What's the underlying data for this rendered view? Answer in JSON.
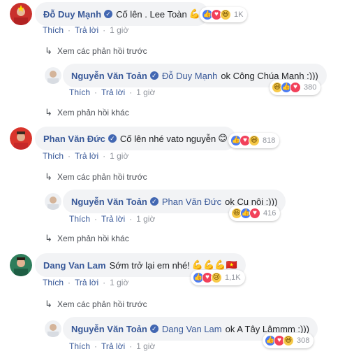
{
  "threads": [
    {
      "comment": {
        "author": "Đỗ Duy Mạnh",
        "text": "Cố lên . Lee Toàn",
        "emoji": "💪",
        "reaction_count": "1K",
        "reactions": [
          "like",
          "love",
          "haha"
        ]
      },
      "actions": {
        "like": "Thích",
        "reply": "Trả lời",
        "time": "1 giờ"
      },
      "more": "Xem các phản hồi trước",
      "reply": {
        "author": "Nguyễn Văn Toản",
        "tag": "Đỗ Duy Mạnh",
        "text": "ok Công Chúa Mạnh :)))",
        "reaction_count": "380",
        "reactions": [
          "haha",
          "like",
          "love"
        ]
      },
      "reply_actions": {
        "like": "Thích",
        "reply": "Trả lời",
        "time": "1 giờ"
      },
      "other": "Xem phản hồi khác"
    },
    {
      "comment": {
        "author": "Phan Văn Đức",
        "text": "Cố lên nhé vato nguyễn",
        "emoji": "😊",
        "reaction_count": "818",
        "reactions": [
          "like",
          "love",
          "haha"
        ]
      },
      "actions": {
        "like": "Thích",
        "reply": "Trả lời",
        "time": "1 giờ"
      },
      "more": "Xem các phản hồi trước",
      "reply": {
        "author": "Nguyễn Văn Toản",
        "tag": "Phan Văn Đức",
        "text": "ok Cụ nội :)))",
        "reaction_count": "416",
        "reactions": [
          "haha",
          "like",
          "love"
        ]
      },
      "reply_actions": {
        "like": "Thích",
        "reply": "Trả lời",
        "time": "1 giờ"
      },
      "other": "Xem phản hồi khác"
    },
    {
      "comment": {
        "author": "Dang Van Lam",
        "text": "Sớm trở lại em nhé!",
        "emoji": "💪💪💪🇻🇳",
        "reaction_count": "1,1K",
        "reactions": [
          "like",
          "love",
          "sad"
        ]
      },
      "actions": {
        "like": "Thích",
        "reply": "Trả lời",
        "time": "1 giờ"
      },
      "more": "Xem các phản hồi trước",
      "reply": {
        "author": "Nguyễn Văn Toản",
        "tag": "Dang Van Lam",
        "text": "ok A Tây Lâmmm :)))",
        "reaction_count": "308",
        "reactions": [
          "like",
          "love",
          "haha"
        ]
      },
      "reply_actions": {
        "like": "Thích",
        "reply": "Trả lời",
        "time": "1 giờ"
      }
    }
  ],
  "icons": {
    "verified": "verified-check-icon",
    "reply_arrow": "reply-arrow-icon",
    "like": "like-reaction-icon",
    "love": "love-reaction-icon",
    "haha": "haha-reaction-icon",
    "sad": "sad-reaction-icon"
  },
  "colors": {
    "link": "#385898",
    "bubble": "#f2f3f5",
    "like": "#4a7cf6",
    "love": "#f2415a",
    "haha": "#f7c948"
  }
}
